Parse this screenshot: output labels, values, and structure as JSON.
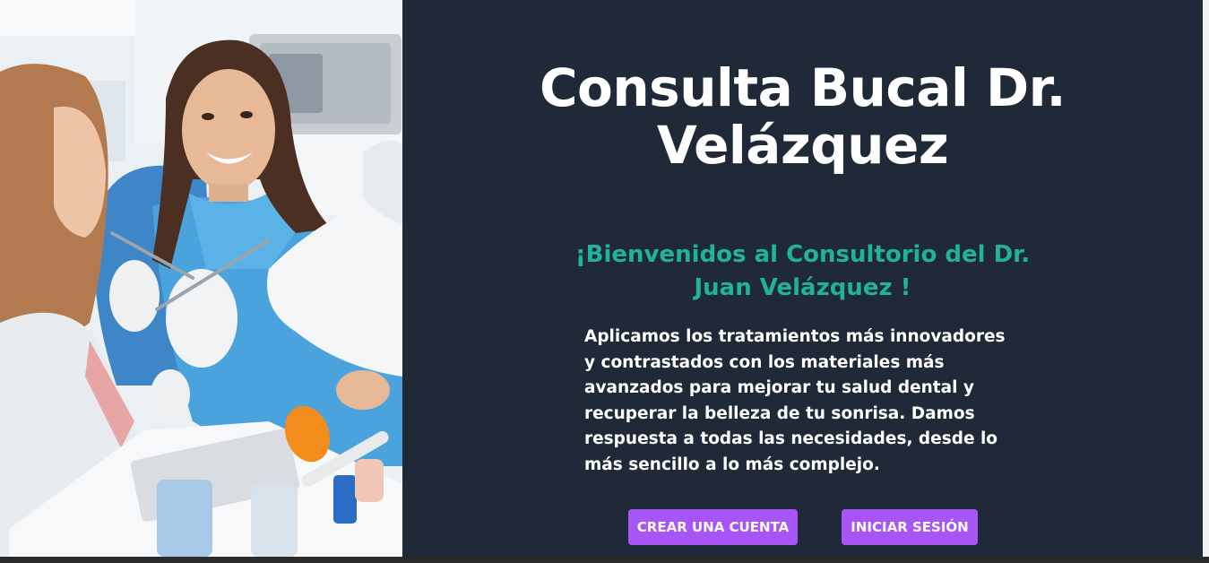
{
  "hero": {
    "title": "Consulta Bucal Dr. Velázquez",
    "subtitle": "¡Bienvenidos al Consultorio del Dr. Juan Velázquez !",
    "description": "Aplicamos los tratamientos más innovadores y contrastados con los materiales más avanzados para mejorar tu salud dental y recuperar la belleza de tu sonrisa. Damos respuesta a todas las necesidades, desde lo más sencillo a lo más complejo."
  },
  "actions": {
    "create_account": "CREAR UNA CUENTA",
    "login": "INICIAR SESIÓN"
  },
  "colors": {
    "panel_bg": "#1f2937",
    "accent_teal": "#20b29a",
    "button_purple": "#a855f7"
  }
}
